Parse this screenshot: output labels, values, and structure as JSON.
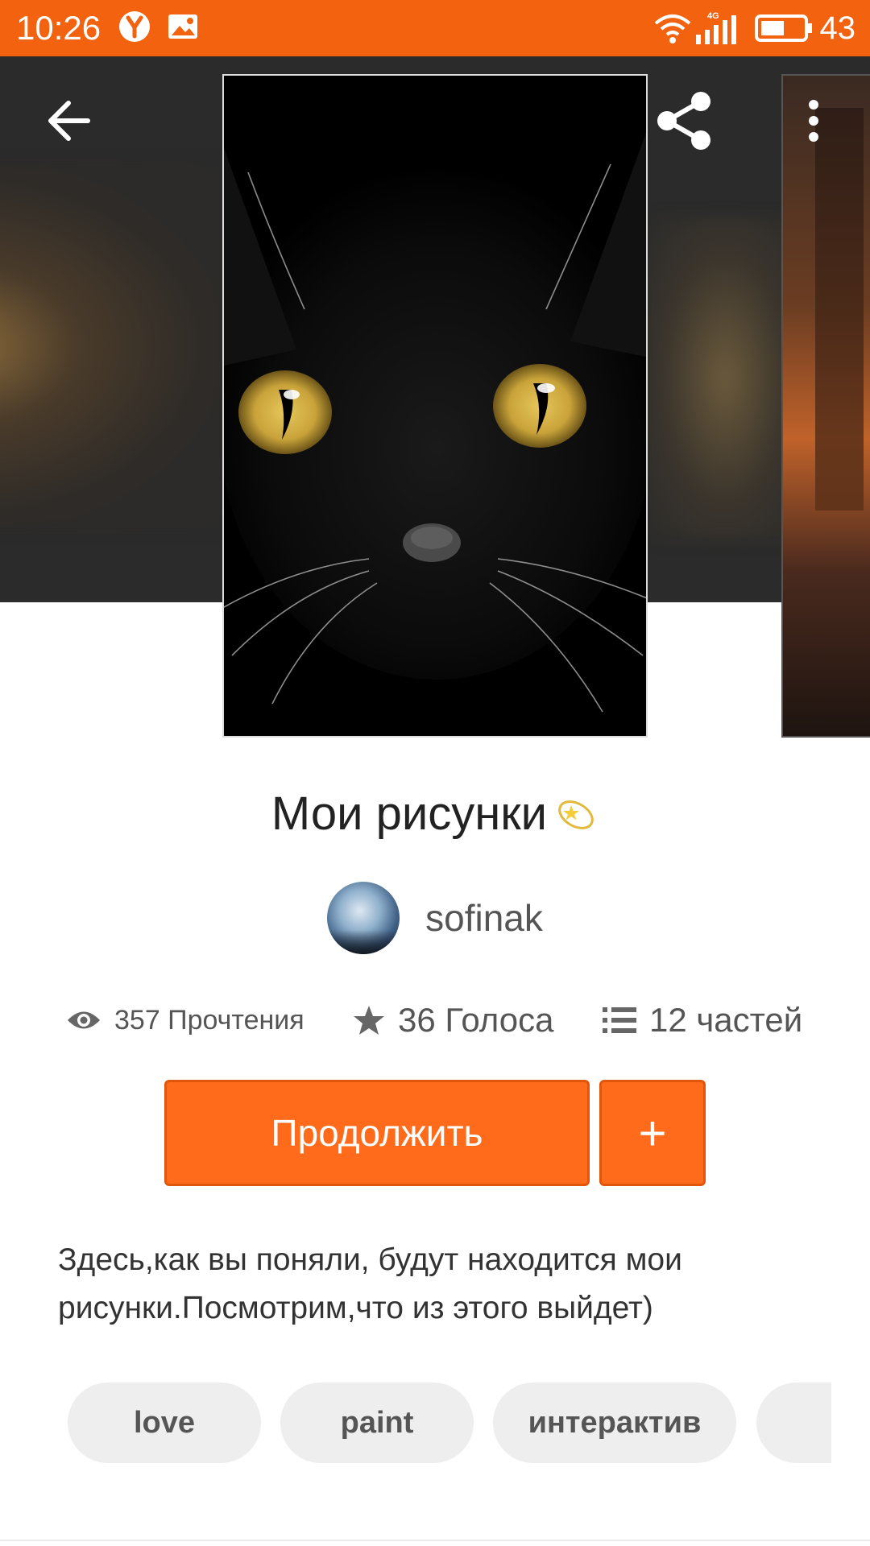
{
  "status_bar": {
    "time": "10:26",
    "battery_level": "43",
    "network": "4G",
    "accent_color": "#f2620f"
  },
  "header": {
    "back_icon": "arrow-left-icon",
    "share_icon": "share-icon",
    "more_icon": "more-vertical-icon"
  },
  "story": {
    "title": "Мои рисунки",
    "title_emoji": "dizzy-star-icon",
    "author": "sofinak",
    "stats": {
      "reads": "357 Прочтения",
      "votes": "36 Голоса",
      "parts": "12 частей"
    },
    "continue_label": "Продолжить",
    "add_label": "+",
    "description": "Здесь,как вы поняли, будут находится мои рисунки.Посмотрим,что из этого выйдет)",
    "tags": [
      "love",
      "paint",
      "интерактив"
    ]
  },
  "colors": {
    "primary_button": "#ff6b1a",
    "tag_background": "#eeeeee"
  }
}
